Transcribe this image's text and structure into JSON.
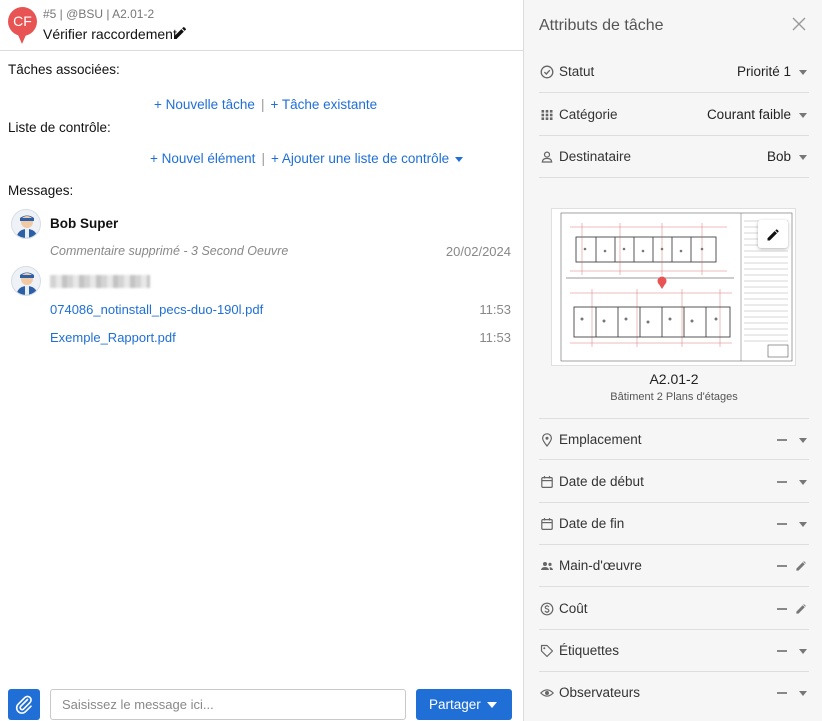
{
  "task": {
    "initials": "CF",
    "meta": "#5 | @BSU | A2.01-2",
    "title": "Vérifier raccordement"
  },
  "colors": {
    "accent": "#1f6fd6",
    "pin": "#e85454",
    "panel_bg": "#f6f6f6"
  },
  "associated_tasks": {
    "label": "Tâches associées:",
    "new_task": "+ Nouvelle tâche",
    "existing_task": "+ Tâche existante"
  },
  "checklist": {
    "label": "Liste de contrôle:",
    "new_item": "+ Nouvel élément",
    "add_list": "+ Ajouter une liste de contrôle"
  },
  "messages": {
    "label": "Messages:",
    "items": [
      {
        "author": "Bob Super",
        "text": "Commentaire supprimé - 3 Second Oeuvre",
        "date": "20/02/2024"
      },
      {
        "attachments": [
          {
            "name": "074086_notinstall_pecs-duo-190l.pdf",
            "time": "11:53"
          },
          {
            "name": "Exemple_Rapport.pdf",
            "time": "11:53"
          }
        ]
      }
    ]
  },
  "composer": {
    "placeholder": "Saisissez le message ici...",
    "share_label": "Partager",
    "attach_icon": "paperclip-icon"
  },
  "attributes_panel": {
    "title": "Attributs de tâche",
    "top": [
      {
        "key": "status",
        "icon": "check-circle-icon",
        "label": "Statut",
        "value": "Priorité 1"
      },
      {
        "key": "category",
        "icon": "grid-icon",
        "label": "Catégorie",
        "value": "Courant faible"
      },
      {
        "key": "assignee",
        "icon": "person-icon",
        "label": "Destinataire",
        "value": "Bob"
      }
    ],
    "plan": {
      "name": "A2.01-2",
      "subtitle": "Bâtiment 2 Plans d'étages"
    },
    "bottom": [
      {
        "key": "location",
        "icon": "location-pin-icon",
        "label": "Emplacement",
        "value": "—",
        "action": "dropdown"
      },
      {
        "key": "start_date",
        "icon": "calendar-icon",
        "label": "Date de début",
        "value": "—",
        "action": "dropdown"
      },
      {
        "key": "end_date",
        "icon": "calendar-icon",
        "label": "Date de fin",
        "value": "—",
        "action": "dropdown"
      },
      {
        "key": "labor",
        "icon": "people-icon",
        "label": "Main-d'œuvre",
        "value": "—",
        "action": "edit"
      },
      {
        "key": "cost",
        "icon": "dollar-circle-icon",
        "label": "Coût",
        "value": "—",
        "action": "edit"
      },
      {
        "key": "tags",
        "icon": "tag-icon",
        "label": "Étiquettes",
        "value": "—",
        "action": "dropdown"
      },
      {
        "key": "observers",
        "icon": "eye-icon",
        "label": "Observateurs",
        "value": "—",
        "action": "dropdown"
      }
    ]
  }
}
